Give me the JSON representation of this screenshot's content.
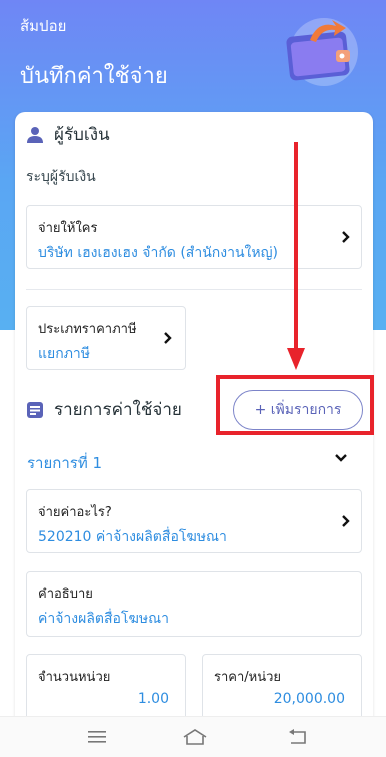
{
  "header": {
    "app_name": "ส้มปอย",
    "title": "บันทึกค่าใช้จ่าย"
  },
  "payee_section": {
    "title": "ผู้รับเงิน",
    "instruction": "ระบุผู้รับเงิน",
    "pay_to": {
      "label": "จ่ายให้ใคร",
      "value": "บริษัท เฮงเฮงเฮง จำกัด (สำนักงานใหญ่)"
    },
    "tax_type": {
      "label": "ประเภทราคาภาษี",
      "value": "แยกภาษี"
    }
  },
  "expense_section": {
    "title": "รายการค่าใช้จ่าย",
    "add_button": "+ เพิ่มรายการ",
    "item_title": "รายการที่ 1",
    "pay_for": {
      "label": "จ่ายค่าอะไร?",
      "value": "520210 ค่าจ้างผลิตสื่อโฆษณา"
    },
    "description": {
      "label": "คำอธิบาย",
      "value": "ค่าจ้างผลิตสื่อโฆษณา"
    },
    "quantity": {
      "label": "จำนวนหน่วย",
      "value": "1.00"
    },
    "unit_price": {
      "label": "ราคา/หน่วย",
      "value": "20,000.00"
    }
  },
  "colors": {
    "header_gradient_top": "#6f86f5",
    "header_gradient_bottom": "#58b0f2",
    "link_blue": "#2e8de0",
    "accent_purple": "#5a63b8",
    "annotation_red": "#e8232b"
  },
  "icons": [
    "wallet-illustration",
    "person-icon",
    "list-icon",
    "chevron-right-icon",
    "chevron-down-icon",
    "menu-icon",
    "home-icon",
    "back-icon"
  ]
}
